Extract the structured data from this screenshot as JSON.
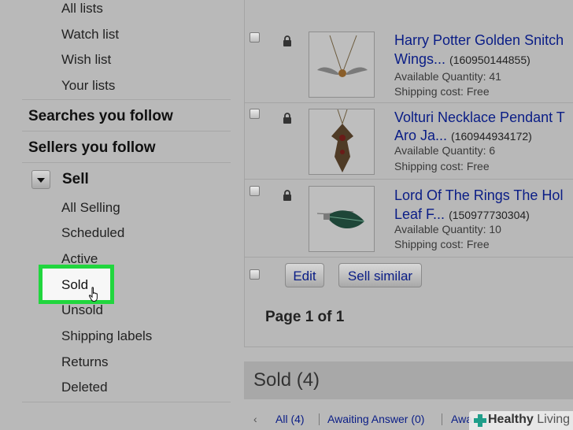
{
  "sidebar": {
    "lists": [
      "All lists",
      "Watch list",
      "Wish list",
      "Your lists"
    ],
    "searches_title": "Searches you follow",
    "sellers_title": "Sellers you follow",
    "sell_title": "Sell",
    "sell_items": [
      "All Selling",
      "Scheduled",
      "Active",
      "Sold",
      "Unsold",
      "Shipping labels",
      "Returns",
      "Deleted"
    ],
    "highlight_color": "#21d63e"
  },
  "listings": [
    {
      "title_line1": "Harry Potter Golden Snitch",
      "title_line2": "Wings...",
      "item_id": "(160950144855)",
      "quantity": "Available Quantity: 41",
      "shipping": "Shipping cost: Free"
    },
    {
      "title_line1": "Volturi Necklace Pendant T",
      "title_line2": "Aro Ja...",
      "item_id": "(160944934172)",
      "quantity": "Available Quantity: 6",
      "shipping": "Shipping cost: Free"
    },
    {
      "title_line1": "Lord Of The Rings The Hol",
      "title_line2": "Leaf F...",
      "item_id": "(150977730304)",
      "quantity": "Available Quantity: 10",
      "shipping": "Shipping cost: Free"
    }
  ],
  "actions": {
    "edit": "Edit",
    "sell_similar": "Sell similar"
  },
  "pagination": {
    "text": "Page 1 of 1"
  },
  "sold_section": {
    "title": "Sold (4)",
    "filters": [
      "All (4)",
      "Awaiting Answer (0)",
      "Awa"
    ]
  },
  "watermark": {
    "brand": "Healthy",
    "suffix": "Living"
  },
  "link_color": "#0a1d86"
}
